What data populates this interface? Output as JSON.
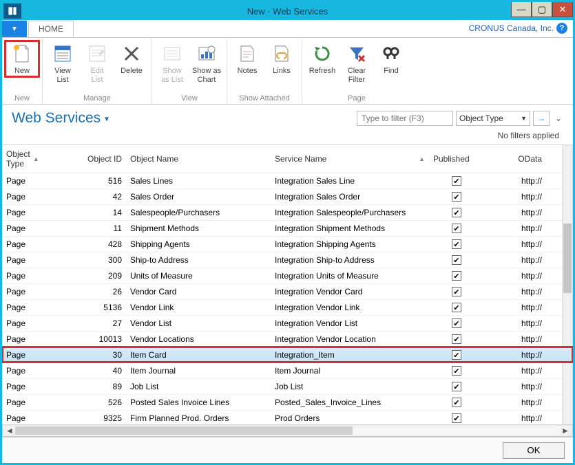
{
  "window": {
    "title": "New - Web Services",
    "company": "CRONUS Canada, Inc."
  },
  "tabs": {
    "home": "HOME"
  },
  "ribbon": {
    "groups": {
      "new": {
        "label": "New",
        "new_btn": "New"
      },
      "manage": {
        "label": "Manage",
        "view_list": "View\nList",
        "edit_list": "Edit\nList",
        "delete": "Delete"
      },
      "view": {
        "label": "View",
        "show_as_list": "Show\nas List",
        "show_as_chart": "Show as\nChart"
      },
      "show_attached": {
        "label": "Show Attached",
        "notes": "Notes",
        "links": "Links"
      },
      "page": {
        "label": "Page",
        "refresh": "Refresh",
        "clear_filter": "Clear\nFilter",
        "find": "Find"
      }
    }
  },
  "page_title": "Web Services",
  "filter": {
    "placeholder": "Type to filter (F3)",
    "type_label": "Object Type",
    "no_filters": "No filters applied"
  },
  "columns": {
    "object_type": "Object\nType",
    "object_id": "Object ID",
    "object_name": "Object Name",
    "service_name": "Service Name",
    "published": "Published",
    "odata": "OData"
  },
  "rows": [
    {
      "type": "Page",
      "id": 516,
      "name": "Sales Lines",
      "service": "Integration Sales Line",
      "published": true,
      "odata": "http://"
    },
    {
      "type": "Page",
      "id": 42,
      "name": "Sales Order",
      "service": "Integration Sales Order",
      "published": true,
      "odata": "http://"
    },
    {
      "type": "Page",
      "id": 14,
      "name": "Salespeople/Purchasers",
      "service": "Integration Salespeople/Purchasers",
      "published": true,
      "odata": "http://"
    },
    {
      "type": "Page",
      "id": 11,
      "name": "Shipment Methods",
      "service": "Integration Shipment Methods",
      "published": true,
      "odata": "http://"
    },
    {
      "type": "Page",
      "id": 428,
      "name": "Shipping Agents",
      "service": "Integration Shipping Agents",
      "published": true,
      "odata": "http://"
    },
    {
      "type": "Page",
      "id": 300,
      "name": "Ship-to Address",
      "service": "Integration Ship-to Address",
      "published": true,
      "odata": "http://"
    },
    {
      "type": "Page",
      "id": 209,
      "name": "Units of Measure",
      "service": "Integration Units of Measure",
      "published": true,
      "odata": "http://"
    },
    {
      "type": "Page",
      "id": 26,
      "name": "Vendor Card",
      "service": "Integration Vendor Card",
      "published": true,
      "odata": "http://"
    },
    {
      "type": "Page",
      "id": 5136,
      "name": "Vendor Link",
      "service": "Integration Vendor Link",
      "published": true,
      "odata": "http://"
    },
    {
      "type": "Page",
      "id": 27,
      "name": "Vendor List",
      "service": "Integration Vendor List",
      "published": true,
      "odata": "http://"
    },
    {
      "type": "Page",
      "id": 10013,
      "name": "Vendor Locations",
      "service": "Integration Vendor Location",
      "published": true,
      "odata": "http://"
    },
    {
      "type": "Page",
      "id": 30,
      "name": "Item Card",
      "service": "Integration_Item",
      "published": true,
      "odata": "http://",
      "selected": true,
      "highlighted": true
    },
    {
      "type": "Page",
      "id": 40,
      "name": "Item Journal",
      "service": "Item Journal",
      "published": true,
      "odata": "http://"
    },
    {
      "type": "Page",
      "id": 89,
      "name": "Job List",
      "service": "Job List",
      "published": true,
      "odata": "http://"
    },
    {
      "type": "Page",
      "id": 526,
      "name": "Posted Sales Invoice Lines",
      "service": "Posted_Sales_Invoice_Lines",
      "published": true,
      "odata": "http://"
    },
    {
      "type": "Page",
      "id": 9325,
      "name": "Firm Planned Prod. Orders",
      "service": "Prod Orders",
      "published": true,
      "odata": "http://"
    }
  ],
  "footer": {
    "ok": "OK"
  }
}
